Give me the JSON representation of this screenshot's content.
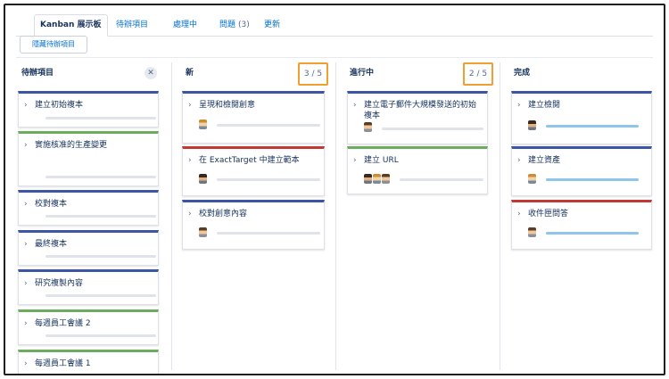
{
  "tabs": [
    {
      "label": "Kanban 展示板",
      "count": ""
    },
    {
      "label": "待辦項目",
      "count": ""
    },
    {
      "label": "處理中",
      "count": ""
    },
    {
      "label": "問題",
      "count": "(3)"
    },
    {
      "label": "更新",
      "count": ""
    }
  ],
  "hide_button": "隱藏待辦項目",
  "columns": [
    {
      "title": "待辦項目",
      "wip": ""
    },
    {
      "title": "新",
      "wip": "3 / 5"
    },
    {
      "title": "進行中",
      "wip": "2 / 5"
    },
    {
      "title": "完成",
      "wip": ""
    }
  ],
  "backlog": [
    {
      "title": "建立初始複本",
      "color": "blue"
    },
    {
      "title": "實施核准的生產變更",
      "color": "green"
    },
    {
      "title": "校對複本",
      "color": "blue"
    },
    {
      "title": "最終複本",
      "color": "blue"
    },
    {
      "title": "研究複製內容",
      "color": "blue"
    },
    {
      "title": "每週員工會議 2",
      "color": "green"
    },
    {
      "title": "每週員工會議 1",
      "color": "green"
    }
  ],
  "new": [
    {
      "title": "呈現和檢閱創意",
      "color": "blue"
    },
    {
      "title": "在 ExactTarget 中建立範本",
      "color": "red"
    },
    {
      "title": "校對創意內容",
      "color": "blue"
    }
  ],
  "in_progress": [
    {
      "title": "建立電子郵件大規模發送的初始複本",
      "color": "blue"
    },
    {
      "title": "建立 URL",
      "color": "green"
    }
  ],
  "done": [
    {
      "title": "建立檢閱",
      "color": "blue",
      "progress": 1.0
    },
    {
      "title": "建立資產",
      "color": "blue",
      "progress": 1.0
    },
    {
      "title": "收件匣問答",
      "color": "red",
      "progress": 1.0
    }
  ],
  "colors": {
    "blue": "#3c56a5",
    "green": "#6cac5d",
    "red": "#c23934",
    "wip_border": "#f0a030",
    "link": "#0070d2"
  },
  "icons": {
    "close": "close-icon",
    "chevron": "chevron-right-icon",
    "avatar": "user-avatar-icon"
  }
}
